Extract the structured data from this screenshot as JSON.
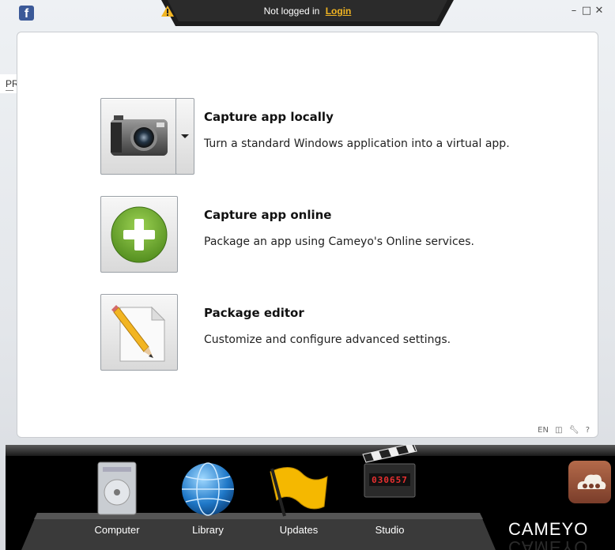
{
  "topbar": {
    "facebook_icon": "facebook-icon",
    "status_text": "Not logged in",
    "login_label": "Login",
    "window_controls": [
      "–",
      "□",
      "✕"
    ]
  },
  "nav": {
    "prev_label": "PREV"
  },
  "actions": [
    {
      "title": "Capture app locally",
      "description": "Turn a standard Windows application into a virtual app.",
      "icon": "camera-icon",
      "has_dropdown": true
    },
    {
      "title": "Capture app online",
      "description": "Package an app using Cameyo's Online services.",
      "icon": "plus-circle-icon",
      "has_dropdown": false
    },
    {
      "title": "Package editor",
      "description": "Customize and configure advanced settings.",
      "icon": "document-pencil-icon",
      "has_dropdown": false
    }
  ],
  "footer": {
    "language": "EN",
    "icons": [
      "window-icon",
      "wrench-icon",
      "help-icon"
    ],
    "help_label": "?"
  },
  "dock": {
    "items": [
      {
        "label": "Computer",
        "icon": "hard-drive-icon"
      },
      {
        "label": "Library",
        "icon": "globe-icon"
      },
      {
        "label": "Updates",
        "icon": "flag-icon"
      },
      {
        "label": "Studio",
        "icon": "clapperboard-icon",
        "counter": "030657"
      }
    ],
    "brand": "CAMEYO"
  },
  "colors": {
    "accent": "#f2b522",
    "facebook": "#3b5998",
    "green": "#6aa22e"
  }
}
